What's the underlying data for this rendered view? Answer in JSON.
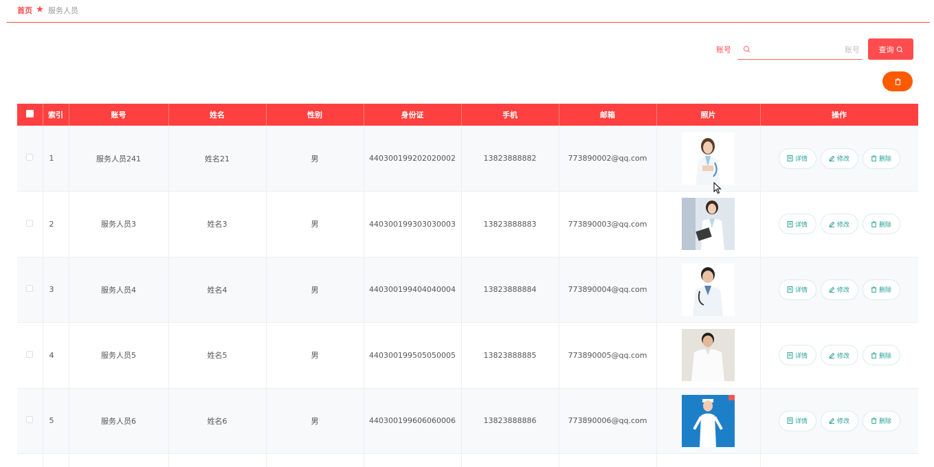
{
  "breadcrumb": {
    "home": "首页",
    "current": "服务人员"
  },
  "search": {
    "label": "账号",
    "placeholder": "账号",
    "value": "",
    "query_label": "查询"
  },
  "colors": {
    "accent": "#ff4040",
    "delete_orange": "#ff5a00",
    "op_text": "#2aa198"
  },
  "table": {
    "headers": {
      "index": "索引",
      "account": "账号",
      "name": "姓名",
      "gender": "性别",
      "id_card": "身份证",
      "phone": "手机",
      "email": "邮箱",
      "photo": "照片",
      "ops": "操作"
    },
    "op_labels": {
      "detail": "详情",
      "edit": "修改",
      "delete": "删除"
    },
    "rows": [
      {
        "index": "1",
        "account": "服务人员241",
        "name": "姓名21",
        "gender": "男",
        "id_card": "440300199202020002",
        "phone": "13823888882",
        "email": "773890002@qq.com",
        "photo": "doctor-female-photo"
      },
      {
        "index": "2",
        "account": "服务人员3",
        "name": "姓名3",
        "gender": "男",
        "id_card": "440300199303030003",
        "phone": "13823888883",
        "email": "773890003@qq.com",
        "photo": "doctor-clipboard-photo"
      },
      {
        "index": "3",
        "account": "服务人员4",
        "name": "姓名4",
        "gender": "男",
        "id_card": "440300199404040004",
        "phone": "13823888884",
        "email": "773890004@qq.com",
        "photo": "doctor-male-photo"
      },
      {
        "index": "4",
        "account": "服务人员5",
        "name": "姓名5",
        "gender": "男",
        "id_card": "440300199505050005",
        "phone": "13823888885",
        "email": "773890005@qq.com",
        "photo": "doctor-male-white-photo"
      },
      {
        "index": "5",
        "account": "服务人员6",
        "name": "姓名6",
        "gender": "男",
        "id_card": "440300199606060006",
        "phone": "13823888886",
        "email": "773890006@qq.com",
        "photo": "nurse-blue-photo"
      }
    ]
  }
}
